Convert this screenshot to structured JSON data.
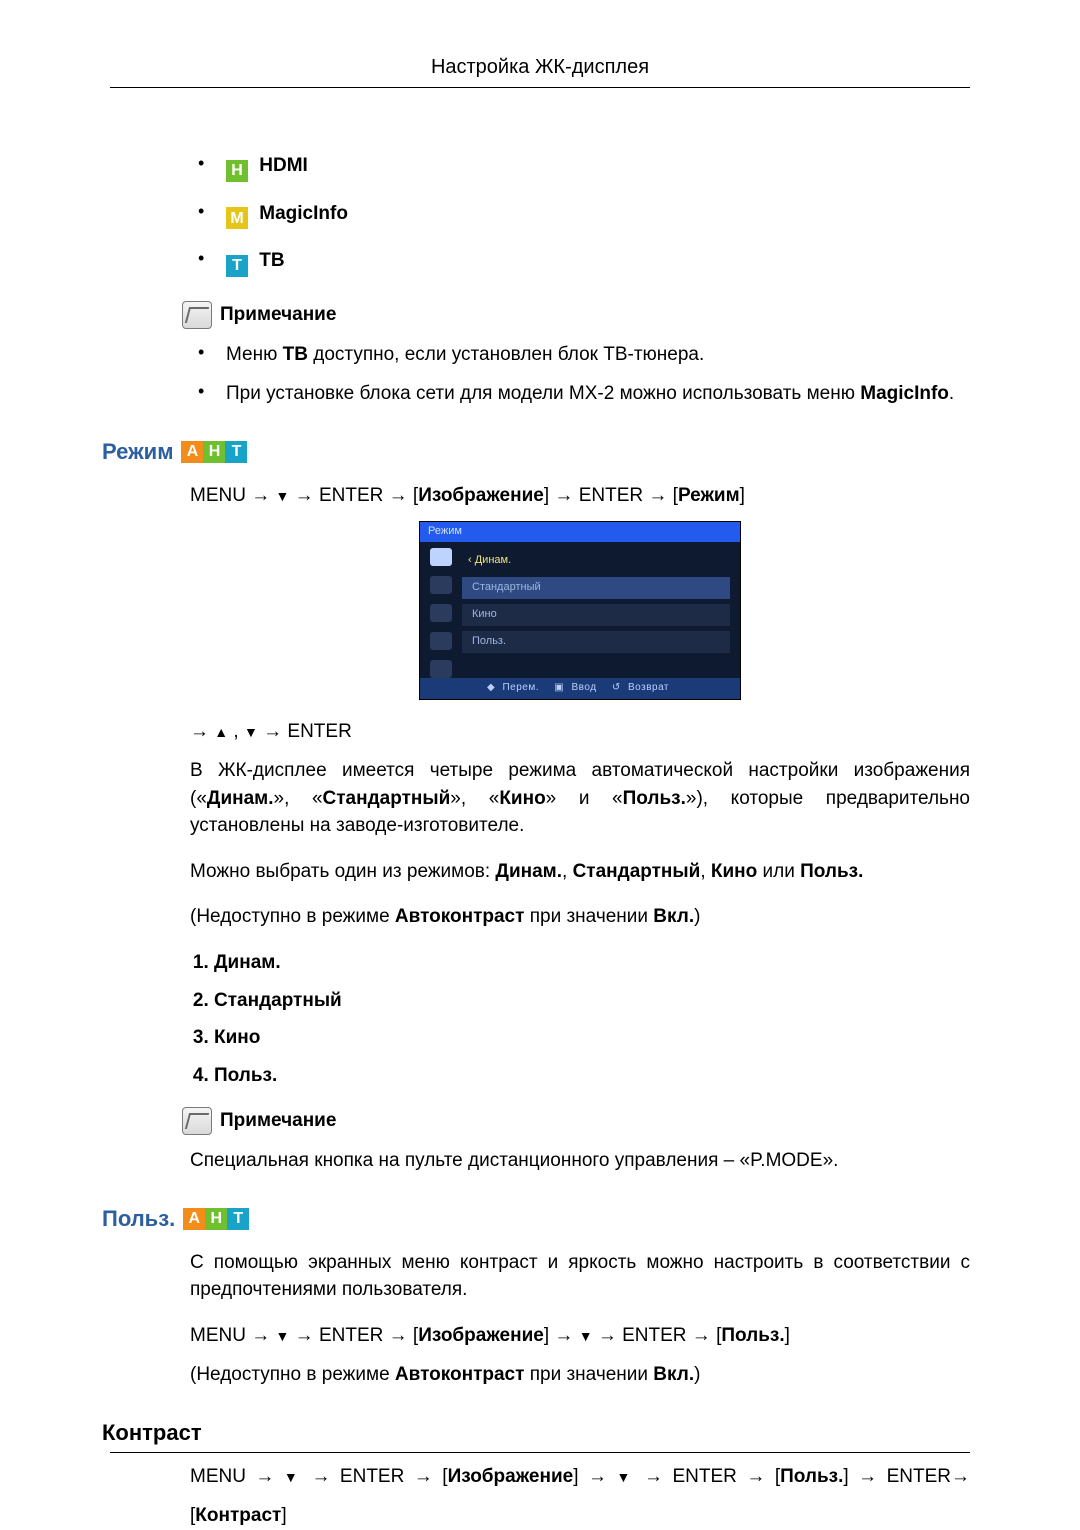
{
  "header": {
    "title": "Настройка ЖК-дисплея"
  },
  "source_list": [
    {
      "icon": "H",
      "color": "green",
      "label": "HDMI"
    },
    {
      "icon": "M",
      "color": "yellow",
      "label": "MagicInfo"
    },
    {
      "icon": "T",
      "color": "cyan",
      "label": "ТВ"
    }
  ],
  "note1": {
    "heading": "Примечание",
    "items": [
      {
        "pre": "Меню ",
        "b1": "ТВ",
        "post": " доступно, если установлен блок ТВ-тюнера."
      },
      {
        "pre": "При установке блока сети для модели MX-2 можно использовать меню ",
        "b1": "MagicInfo",
        "post": "."
      }
    ]
  },
  "mode_section": {
    "title": "Режим",
    "path1": {
      "txt1": "MENU",
      "txt2": "ENTER",
      "br1": "Изображение",
      "txt3": "ENTER",
      "br2": "Режим"
    },
    "osd": {
      "head": "Режим",
      "rows": [
        "Динам.",
        "Стандартный",
        "Кино",
        "Польз."
      ],
      "foot": {
        "move": "Перем.",
        "enter": "Ввод",
        "ret": "Возврат"
      }
    },
    "path2_enter": "ENTER",
    "body1_parts": {
      "a": "В ЖК-дисплее имеется четыре режима автоматической настройки изображения («",
      "b1": "Динам.",
      "s1": "», «",
      "b2": "Стандартный",
      "s2": "», «",
      "b3": "Кино",
      "s3": "» и «",
      "b4": "Польз.",
      "c": "»), которые предварительно установлены на заводе-изготовителе."
    },
    "body2": {
      "a": "Можно выбрать один из режимов: ",
      "m1": "Динам.",
      "c1": ", ",
      "m2": "Стандартный",
      "c2": ", ",
      "m3": "Кино",
      "c3": " или ",
      "m4": "Польз.",
      "end": ""
    },
    "body3": {
      "a": "(Недоступно в режиме ",
      "b": "Автоконтраст",
      "c": " при значении ",
      "d": "Вкл.",
      "e": ")"
    },
    "list": [
      "Динам.",
      "Стандартный",
      "Кино",
      "Польз."
    ],
    "note2_heading": "Примечание",
    "note2_text": "Специальная кнопка на пульте дистанционного управления – «P.MODE»."
  },
  "custom_section": {
    "title": "Польз.",
    "body": "С помощью экранных меню контраст и яркость можно настроить в соответствии с предпочтениями пользователя.",
    "path": {
      "txt1": "MENU",
      "txt2": "ENTER",
      "br1": "Изображение",
      "txt3": "ENTER",
      "br2": "Польз."
    },
    "body3": {
      "a": "(Недоступно в режиме ",
      "b": "Автоконтраст",
      "c": " при значении ",
      "d": "Вкл.",
      "e": ")"
    }
  },
  "contrast_section": {
    "title": "Контраст",
    "path": {
      "txt1": "MENU",
      "txt2": "ENTER",
      "br1": "Изображение",
      "txt3": "ENTER",
      "br2": "Польз.",
      "txt4": "ENTER",
      "br3": "Контраст"
    }
  }
}
